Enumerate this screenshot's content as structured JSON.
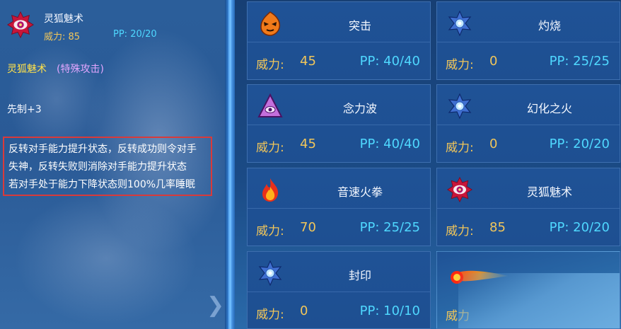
{
  "selected_skill": {
    "name": "灵狐魅术",
    "power_text": "威力: 85",
    "pp_text": "PP: 20/20",
    "icon": "fox-charm-icon"
  },
  "description": {
    "name": "灵狐魅术",
    "category": "(特殊攻击)",
    "priority": "先制+3",
    "effect_lines": [
      "反转对手能力提升状态，反转成功则令对手",
      "失神，反转失败则消除对手能力提升状态",
      "若对手处于能力下降状态则100%几率睡眠"
    ]
  },
  "skills": [
    {
      "name": "突击",
      "power_label": "威力:",
      "power": "45",
      "pp": "PP: 40/40",
      "icon": "fire-mask-icon"
    },
    {
      "name": "灼烧",
      "power_label": "威力:",
      "power": "0",
      "pp": "PP: 25/25",
      "icon": "star-emblem-icon"
    },
    {
      "name": "念力波",
      "power_label": "威力:",
      "power": "45",
      "pp": "PP: 40/40",
      "icon": "psychic-triangle-icon"
    },
    {
      "name": "幻化之火",
      "power_label": "威力:",
      "power": "0",
      "pp": "PP: 20/20",
      "icon": "star-emblem-icon"
    },
    {
      "name": "音速火拳",
      "power_label": "威力:",
      "power": "70",
      "pp": "PP: 25/25",
      "icon": "flame-icon"
    },
    {
      "name": "灵狐魅术",
      "power_label": "威力:",
      "power": "85",
      "pp": "PP: 20/20",
      "icon": "fox-charm-icon"
    },
    {
      "name": "封印",
      "power_label": "威力:",
      "power": "0",
      "pp": "PP: 10/10",
      "icon": "star-emblem-icon"
    },
    {
      "name": "",
      "power_label": "威力",
      "power": "",
      "pp": "",
      "icon": "fire-streak-icon"
    }
  ],
  "colors": {
    "power": "#f1c65a",
    "pp": "#4fd8ff",
    "highlight_border": "#d93a3a",
    "skill_name_yellow": "#ffe14a",
    "category_purple": "#e3a6ff"
  }
}
